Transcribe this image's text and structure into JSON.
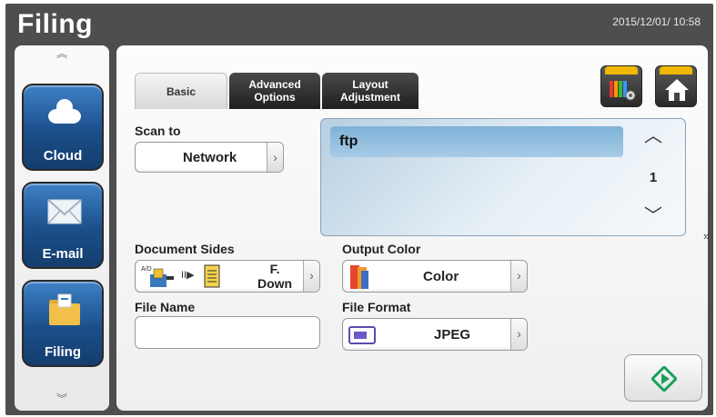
{
  "header": {
    "title": "Filing",
    "datetime": "2015/12/01/ 10:58"
  },
  "sidebar": {
    "items": [
      {
        "label": "Cloud",
        "icon": "cloud-icon"
      },
      {
        "label": "E-mail",
        "icon": "envelope-icon"
      },
      {
        "label": "Filing",
        "icon": "folder-icon"
      }
    ]
  },
  "tabs": [
    {
      "label": "Basic",
      "selected": true
    },
    {
      "label": "Advanced Options",
      "selected": false
    },
    {
      "label": "Layout Adjustment",
      "selected": false
    }
  ],
  "form": {
    "scan_to": {
      "label": "Scan to",
      "value": "Network"
    },
    "destination_list": {
      "items": [
        "ftp"
      ],
      "page": "1"
    },
    "document_sides": {
      "label": "Document Sides",
      "value_line1": "F.",
      "value_line2": "Down"
    },
    "output_color": {
      "label": "Output Color",
      "value": "Color"
    },
    "file_name": {
      "label": "File Name",
      "value": ""
    },
    "file_format": {
      "label": "File Format",
      "value": "JPEG"
    }
  },
  "colors": {
    "accent_blue": "#1b4f8a",
    "tab_dark": "#1f1f1f",
    "list_highlight": "#7fb2d8",
    "start_green": "#1aa05a",
    "top_icon_bar": "#f0b800"
  }
}
